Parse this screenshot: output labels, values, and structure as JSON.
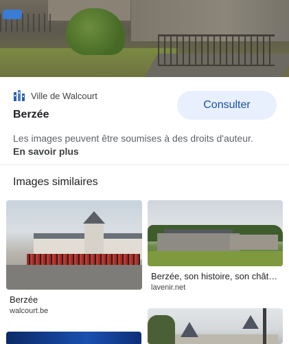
{
  "hero": {
    "description_icon": "photo"
  },
  "source": {
    "logo_icon": "city-logo-icon",
    "name": "Ville de Walcourt"
  },
  "title": "Berzée",
  "consult_button": "Consulter",
  "notice": {
    "text": "Les images peuvent être soumises à des droits d'auteur.",
    "link": "En savoir plus"
  },
  "similar": {
    "heading": "Images similaires",
    "items": [
      {
        "title": "Berzée",
        "domain": "walcourt.be"
      },
      {
        "title": "Berzée, son histoire, son chât…",
        "domain": "lavenir.net"
      },
      {
        "title": "",
        "domain": ""
      },
      {
        "title": "",
        "domain": ""
      }
    ]
  },
  "colors": {
    "accent": "#174ea6",
    "button_bg": "#e8f0fe",
    "text": "#202124",
    "secondary_text": "#5f6368"
  }
}
